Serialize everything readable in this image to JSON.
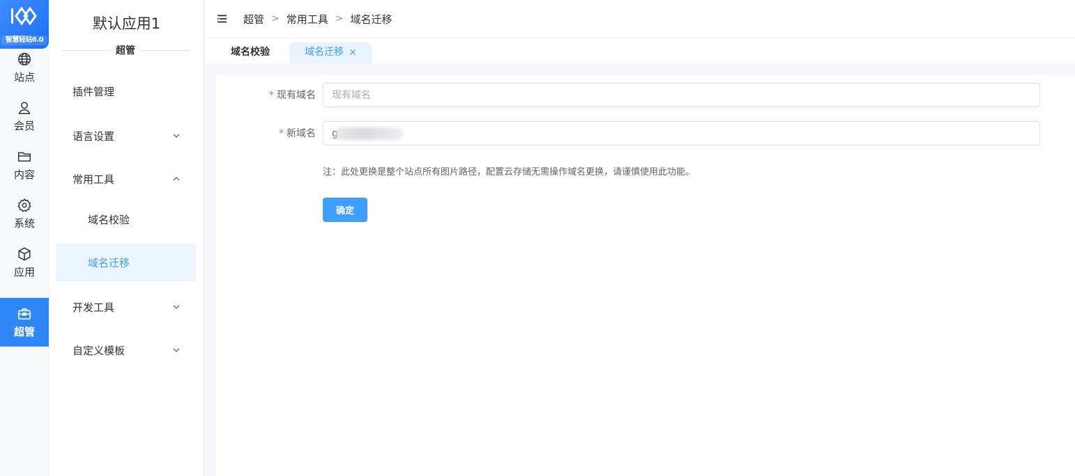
{
  "brand": {
    "logo_text": "智慧轻站6.0"
  },
  "rail": {
    "items": [
      {
        "label": "站点",
        "icon": "globe-icon"
      },
      {
        "label": "会员",
        "icon": "user-icon"
      },
      {
        "label": "内容",
        "icon": "folder-icon"
      },
      {
        "label": "系统",
        "icon": "gear-icon"
      },
      {
        "label": "应用",
        "icon": "cube-icon"
      },
      {
        "label": "超管",
        "icon": "briefcase-icon",
        "active": true
      }
    ]
  },
  "sidebar": {
    "app_title": "默认应用1",
    "section": "超管",
    "items": [
      {
        "label": "插件管理"
      },
      {
        "label": "语言设置"
      },
      {
        "label": "常用工具"
      },
      {
        "label": "域名校验"
      },
      {
        "label": "域名迁移",
        "active": true
      },
      {
        "label": "开发工具"
      },
      {
        "label": "自定义模板"
      }
    ]
  },
  "header": {
    "breadcrumb": [
      "超管",
      "常用工具",
      "域名迁移"
    ],
    "separator": ">"
  },
  "tabs": [
    {
      "label": "域名校验"
    },
    {
      "label": "域名迁移",
      "active": true
    }
  ],
  "form": {
    "current_domain": {
      "label": "现有域名",
      "placeholder": "现有域名",
      "value": ""
    },
    "new_domain": {
      "label": "新域名",
      "value": "g"
    },
    "required_mark": "*",
    "note": "注：此处更换是整个站点所有图片路径，配置云存储无需操作域名更换，请谨慎使用此功能。",
    "submit_label": "确定"
  },
  "colors": {
    "primary": "#409eff",
    "rail_active": "#2f86f6",
    "required": "#f56c6c"
  }
}
